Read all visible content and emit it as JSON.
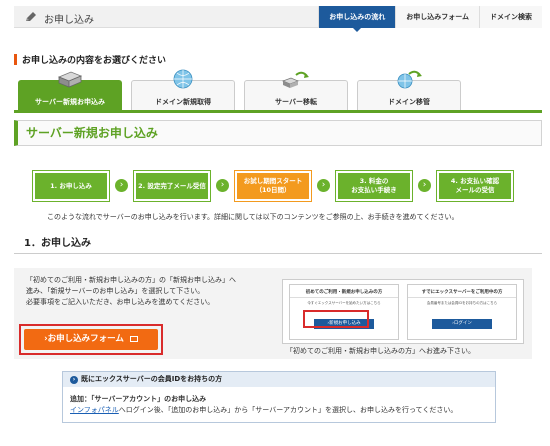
{
  "header": {
    "title": "お申し込み",
    "nav": [
      {
        "label": "お申し込みの流れ",
        "active": true
      },
      {
        "label": "お申し込みフォーム",
        "active": false
      },
      {
        "label": "ドメイン検索",
        "active": false
      }
    ]
  },
  "select_heading": "お申し込みの内容をお選びください",
  "tabs": [
    {
      "label": "サーバー新規お申込み",
      "icon": "server-icon",
      "active": true
    },
    {
      "label": "ドメイン新規取得",
      "icon": "globe-icon",
      "active": false
    },
    {
      "label": "サーバー移転",
      "icon": "server-transfer-icon",
      "active": false
    },
    {
      "label": "ドメイン移管",
      "icon": "globe-transfer-icon",
      "active": false
    }
  ],
  "page_title": "サーバー新規お申し込み",
  "steps": [
    {
      "line1": "1. お申し込み",
      "line2": ""
    },
    {
      "line1": "2. 設定完了メール受信",
      "line2": ""
    },
    {
      "line1": "お試し期間スタート",
      "line2": "（10日間）",
      "highlight": true
    },
    {
      "line1": "3. 料金の",
      "line2": "お支払い手続き"
    },
    {
      "line1": "4. お支払い確認",
      "line2": "メールの受信"
    }
  ],
  "flow_description": "このような流れでサーバーのお申し込みを行います。詳細に関しては以下のコンテンツをご参照の上、お手続きを進めてください。",
  "section1_title": "1．お申し込み",
  "panel": {
    "line1": "「初めてのご利用・新規お申し込みの方」の「新規お申し込み」へ",
    "line2": "進み、「新規サーバーのお申し込み」を選択して下さい。",
    "line3": "必要事項をご記入いただき、お申し込みを進めてください。",
    "button_label": "›お申し込みフォーム",
    "screenshot": {
      "left_title": "初めてのご利用・新規お申し込みの方",
      "left_text": "今すぐエックスサーバーを始めたい方はこちら",
      "left_button": "›新規お申し込み",
      "right_title": "すでにエックスサーバーをご利用中の方",
      "right_text": "会員番号または会員IDをお持ちの方はこちら",
      "right_button": "›ログイン"
    },
    "caption": "「初めてのご利用・新規お申し込みの方」へお進み下さい。"
  },
  "member": {
    "title": "既にエックスサーバーの会員IDをお持ちの方",
    "line1": "追加：「サーバーアカウント」のお申し込み",
    "link": "インフォパネル",
    "line2": "へログイン後、「追加のお申し込み」から「サーバーアカウント」を選択し、お申し込みを行ってください。"
  },
  "colors": {
    "green": "#5ea224",
    "orange": "#f39a1e",
    "navy": "#1d5a9c",
    "red": "#d92b2b"
  }
}
